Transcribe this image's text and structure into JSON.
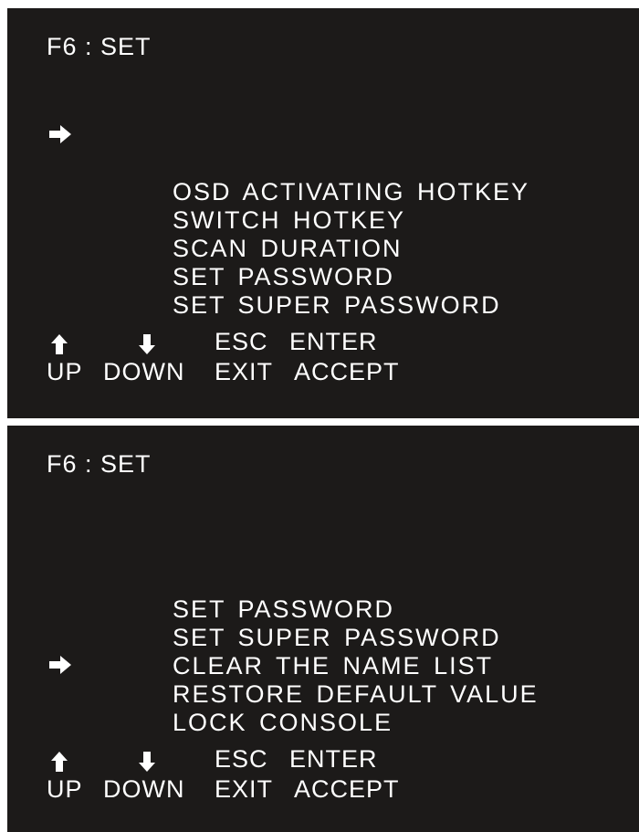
{
  "screens": [
    {
      "title": "F6 : SET",
      "menu": [
        {
          "label": "OSD ACTIVATING HOTKEY",
          "selected": true
        },
        {
          "label": "SWITCH HOTKEY",
          "selected": false
        },
        {
          "label": "SCAN DURATION",
          "selected": false
        },
        {
          "label": "SET PASSWORD",
          "selected": false
        },
        {
          "label": "SET SUPER PASSWORD",
          "selected": false
        }
      ],
      "keys": {
        "up_icon": "up-arrow-icon",
        "down_icon": "down-arrow-icon",
        "esc": "ESC",
        "enter": "ENTER",
        "up_label": "UP",
        "down_label": "DOWN",
        "exit_label": "EXIT",
        "accept_label": "ACCEPT"
      }
    },
    {
      "title": "F6 : SET",
      "menu": [
        {
          "label": "SET PASSWORD",
          "selected": false
        },
        {
          "label": "SET SUPER PASSWORD",
          "selected": false
        },
        {
          "label": "CLEAR THE NAME LIST",
          "selected": false
        },
        {
          "label": "RESTORE DEFAULT VALUE",
          "selected": false
        },
        {
          "label": "LOCK CONSOLE",
          "selected": true
        }
      ],
      "keys": {
        "up_icon": "up-arrow-icon",
        "down_icon": "down-arrow-icon",
        "esc": "ESC",
        "enter": "ENTER",
        "up_label": "UP",
        "down_label": "DOWN",
        "exit_label": "EXIT",
        "accept_label": "ACCEPT"
      }
    }
  ],
  "colors": {
    "screen_background": "#1c1a19",
    "text": "#ffffff",
    "page_background": "#ffffff"
  }
}
